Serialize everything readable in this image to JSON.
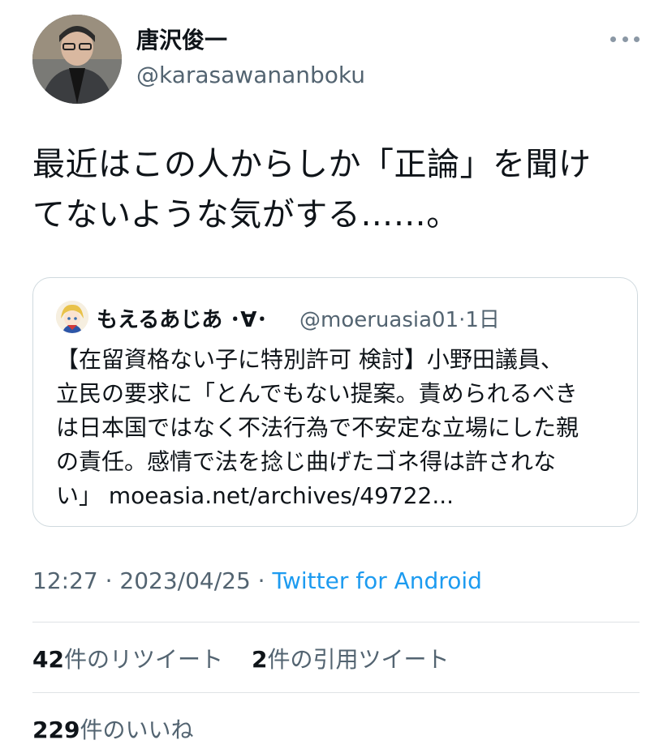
{
  "author": {
    "display_name": "唐沢俊一",
    "handle": "@karasawananboku"
  },
  "tweet": {
    "text_line1": "最近はこの人からしか「正論」を聞け",
    "text_line2": "てないような気がする……。"
  },
  "quote": {
    "display_name": "もえるあじあ ･∀･",
    "handle_time": "@moeruasia01·1日",
    "text_lines": [
      "【在留資格ない子に特別許可 検討】小野田議員、",
      "立民の要求に「とんでもない提案。責められるべき",
      "は日本国ではなく不法行為で不安定な立場にした親",
      "の責任。感情で法を捻じ曲げたゴネ得は許されな",
      "い」 moeasia.net/archives/49722..."
    ]
  },
  "meta": {
    "time_date": "12:27 · 2023/04/25 · ",
    "source": "Twitter for Android"
  },
  "stats": {
    "retweets_count": "42",
    "retweets_label": "件のリツイート",
    "quotes_count": "2",
    "quotes_label": "件の引用ツイート",
    "likes_count": "229",
    "likes_label": "件のいいね"
  },
  "colors": {
    "text": "#0f1419",
    "secondary": "#536471",
    "link": "#1d9bf0",
    "border": "#cfd9de"
  }
}
